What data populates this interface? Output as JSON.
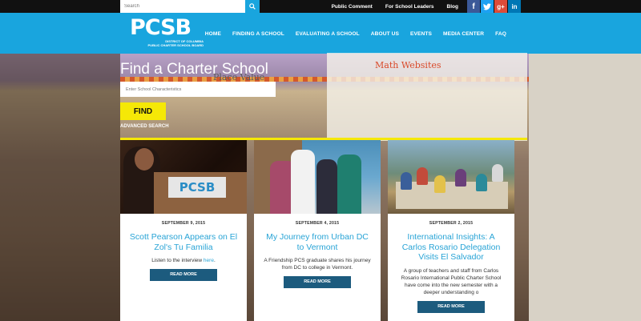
{
  "topbar": {
    "search_placeholder": "Search",
    "links": [
      "Public Comment",
      "For School Leaders",
      "Blog"
    ],
    "social": [
      {
        "name": "facebook",
        "glyph": "f",
        "color": "#3b5998"
      },
      {
        "name": "twitter",
        "glyph": "t",
        "color": "#1da1f2"
      },
      {
        "name": "google-plus",
        "glyph": "g+",
        "color": "#dd4b39"
      },
      {
        "name": "linkedin",
        "glyph": "in",
        "color": "#0077b5"
      }
    ]
  },
  "header": {
    "logo_mark": "PCSB",
    "logo_sub_1": "DISTRICT OF COLUMBIA",
    "logo_sub_2": "PUBLIC CHARTER SCHOOL BOARD",
    "nav": [
      "HOME",
      "FINDING A SCHOOL",
      "EVALUATING A SCHOOL",
      "ABOUT US",
      "EVENTS",
      "MEDIA CENTER",
      "FAQ"
    ],
    "accent_color": "#19a5de"
  },
  "hero": {
    "title": "Find a Charter School",
    "input_placeholder": "Enter School Characteristics",
    "find_label": "FIND",
    "advanced_label": "ADVANCED SEARCH",
    "board_text_1": "Math Websites",
    "board_text_2": "Place Value"
  },
  "cards": [
    {
      "date": "SEPTEMBER 9, 2015",
      "title": "Scott Pearson Appears on El Zol's Tu Familia",
      "text_prefix": "Listen to the interview ",
      "link_text": "here",
      "text_suffix": ".",
      "button": "READ MORE",
      "photo_sign": "PCSB"
    },
    {
      "date": "SEPTEMBER 4, 2015",
      "title": "My Journey from Urban DC to Vermont",
      "text": "A Friendship PCS graduate shares his journey from DC to college in Vermont.",
      "button": "READ MORE"
    },
    {
      "date": "SEPTEMBER 2, 2015",
      "title": "International Insights: A Carlos Rosario Delegation Visits El Salvador",
      "text": "A group of teachers and staff from Carlos Rosario International Public Charter School have come into the new semester with a deeper understanding o",
      "button": "READ MORE"
    }
  ]
}
